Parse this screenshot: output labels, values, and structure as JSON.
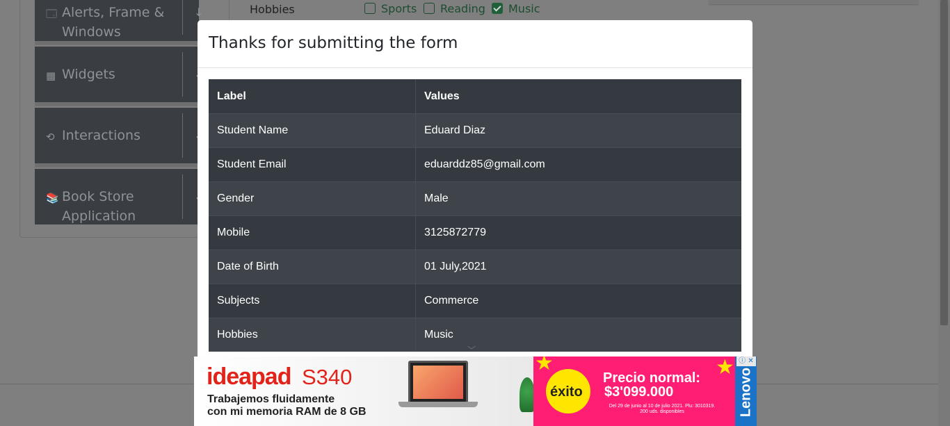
{
  "background": {
    "menu": [
      {
        "label": "Alerts, Frame & Windows",
        "line1": "Alerts, Frame &",
        "line2": "Windows",
        "icon": "window-icon",
        "glyph": "🗔"
      },
      {
        "label": "Widgets",
        "icon": "widgets-icon",
        "glyph": "▦"
      },
      {
        "label": "Interactions",
        "icon": "interactions-icon",
        "glyph": "⟲"
      },
      {
        "label": "Book Store Application",
        "line1": "Book Store",
        "line2": "Application",
        "icon": "books-icon",
        "glyph": "📚"
      }
    ],
    "hobbies_label": "Hobbies",
    "hobbies": [
      {
        "label": "Sports",
        "checked": false
      },
      {
        "label": "Reading",
        "checked": false
      },
      {
        "label": "Music",
        "checked": true
      }
    ]
  },
  "modal": {
    "title": "Thanks for submitting the form",
    "headers": {
      "label": "Label",
      "values": "Values"
    },
    "rows": [
      {
        "label": "Student Name",
        "value": "Eduard Diaz"
      },
      {
        "label": "Student Email",
        "value": "eduarddz85@gmail.com"
      },
      {
        "label": "Gender",
        "value": "Male"
      },
      {
        "label": "Mobile",
        "value": "3125872779"
      },
      {
        "label": "Date of Birth",
        "value": "01 July,2021"
      },
      {
        "label": "Subjects",
        "value": "Commerce"
      },
      {
        "label": "Hobbies",
        "value": "Music"
      }
    ]
  },
  "ad": {
    "brand": "ideapad",
    "model": "S340",
    "tagline1": "Trabajemos fluidamente",
    "tagline2": "con mi memoria RAM de 8 GB",
    "store": "éxito",
    "price_label": "Precio normal:",
    "price": "$3'099.000",
    "fine_print1": "Del 29 de junio al 10 de julio 2021. Plu: 3010319.",
    "fine_print2": "200 uds. disponibles",
    "sponsor": "Lenovo",
    "adchoices": "ⓘ ✕"
  },
  "colors": {
    "accent": "#e2231a",
    "ad_pink": "#ff1e73",
    "lenovo_blue": "#1a73c7",
    "table_dark": "#343a40"
  }
}
